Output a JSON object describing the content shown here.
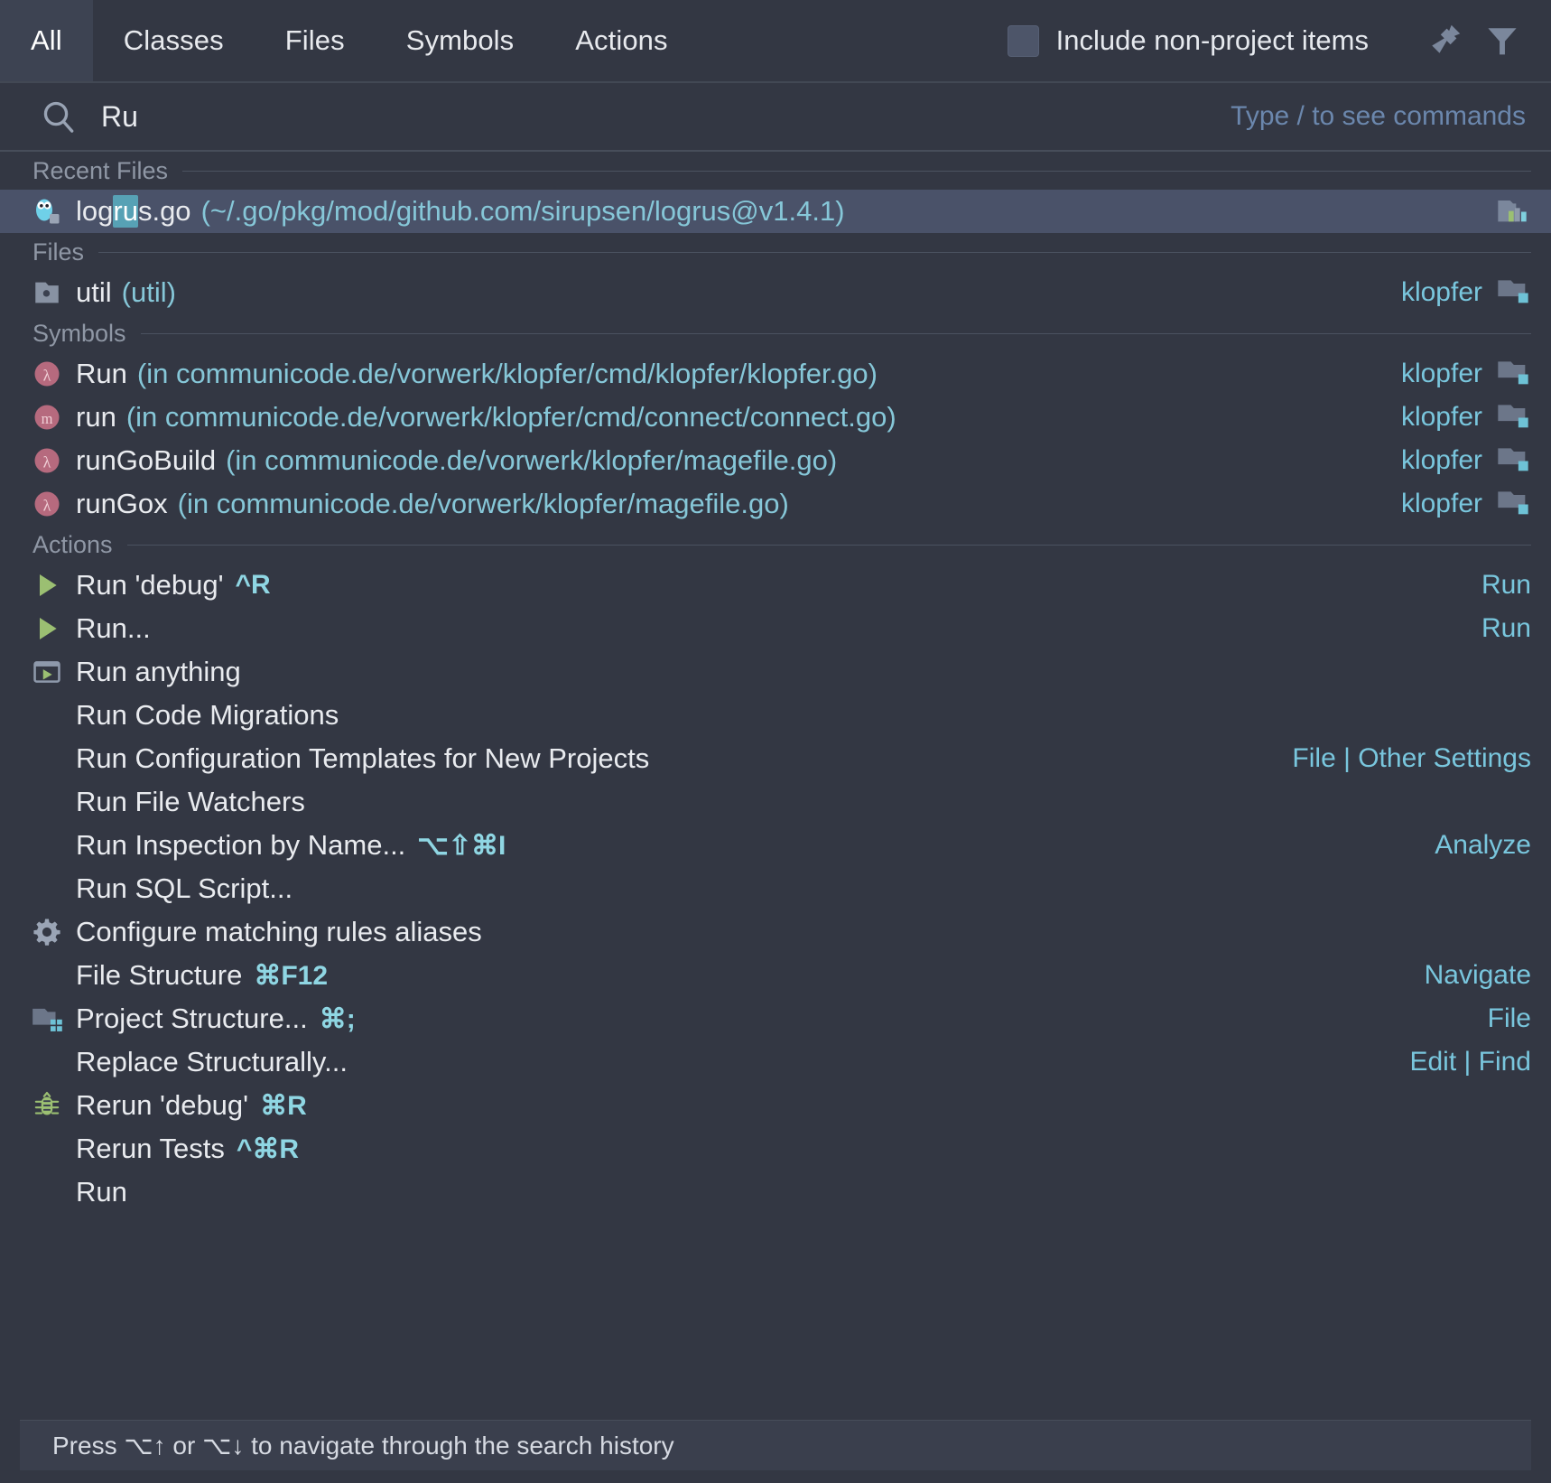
{
  "dialog": {
    "name": "Search Everywhere"
  },
  "tabs": [
    {
      "label": "All",
      "active": true
    },
    {
      "label": "Classes",
      "active": false
    },
    {
      "label": "Files",
      "active": false
    },
    {
      "label": "Symbols",
      "active": false
    },
    {
      "label": "Actions",
      "active": false
    }
  ],
  "toolbar": {
    "include_non_project_label": "Include non-project items",
    "include_non_project_checked": false,
    "pin_icon": "pin-icon",
    "filter_icon": "filter-icon"
  },
  "search": {
    "icon": "search-icon",
    "value": "Ru",
    "placeholder": "Type / to see commands",
    "hint": "Type / to see commands",
    "match_prefix": "log",
    "match_highlight": "ru"
  },
  "groups": [
    {
      "title": "Recent Files"
    },
    {
      "title": "Files"
    },
    {
      "title": "Symbols"
    },
    {
      "title": "Actions"
    }
  ],
  "recent_files": [
    {
      "icon": "go-gopher-file-icon",
      "name_before": "log",
      "name_match": "ru",
      "name_after": "s.go",
      "location": "(~/.go/pkg/mod/github.com/sirupsen/logrus@v1.4.1)",
      "right_icon": "library-module-icon",
      "selected": true
    }
  ],
  "files": [
    {
      "icon": "folder-file-icon",
      "name": "util",
      "location": "(util)",
      "right_text": "klopfer",
      "right_icon": "module-icon"
    }
  ],
  "symbols": [
    {
      "icon": "lambda-function-icon",
      "name": "Run",
      "location": "(in communicode.de/vorwerk/klopfer/cmd/klopfer/klopfer.go)",
      "right_text": "klopfer",
      "right_icon": "module-icon"
    },
    {
      "icon": "method-icon",
      "name": "run",
      "location": "(in communicode.de/vorwerk/klopfer/cmd/connect/connect.go)",
      "right_text": "klopfer",
      "right_icon": "module-icon"
    },
    {
      "icon": "lambda-function-icon",
      "name": "runGoBuild",
      "location": "(in communicode.de/vorwerk/klopfer/magefile.go)",
      "right_text": "klopfer",
      "right_icon": "module-icon"
    },
    {
      "icon": "lambda-function-icon",
      "name": "runGox",
      "location": "(in communicode.de/vorwerk/klopfer/magefile.go)",
      "right_text": "klopfer",
      "right_icon": "module-icon"
    }
  ],
  "actions": [
    {
      "icon": "run-play-icon",
      "label": "Run 'debug'",
      "shortcut": "^R",
      "right_text": "Run"
    },
    {
      "icon": "run-play-icon",
      "label": "Run...",
      "shortcut": "",
      "right_text": "Run"
    },
    {
      "icon": "run-anything-icon",
      "label": "Run anything",
      "shortcut": "",
      "right_text": ""
    },
    {
      "icon": "",
      "label": "Run Code Migrations",
      "shortcut": "",
      "right_text": ""
    },
    {
      "icon": "",
      "label": "Run Configuration Templates for New Projects",
      "shortcut": "",
      "right_text": "File | Other Settings"
    },
    {
      "icon": "",
      "label": "Run File Watchers",
      "shortcut": "",
      "right_text": ""
    },
    {
      "icon": "",
      "label": "Run Inspection by Name...",
      "shortcut": "⌥⇧⌘I",
      "right_text": "Analyze"
    },
    {
      "icon": "",
      "label": "Run SQL Script...",
      "shortcut": "",
      "right_text": ""
    },
    {
      "icon": "gear-icon",
      "label": "Configure matching rules aliases",
      "shortcut": "",
      "right_text": ""
    },
    {
      "icon": "",
      "label": "File Structure",
      "shortcut": "⌘F12",
      "right_text": "Navigate"
    },
    {
      "icon": "project-structure-icon",
      "label": "Project Structure...",
      "shortcut": "⌘;",
      "right_text": "File"
    },
    {
      "icon": "",
      "label": "Replace Structurally...",
      "shortcut": "",
      "right_text": "Edit | Find"
    },
    {
      "icon": "debug-bug-icon",
      "label": "Rerun 'debug'",
      "shortcut": "⌘R",
      "right_text": ""
    },
    {
      "icon": "",
      "label": "Rerun Tests",
      "shortcut": "^⌘R",
      "right_text": ""
    },
    {
      "icon": "",
      "label": "Run",
      "shortcut": "",
      "right_text": ""
    }
  ],
  "footer": {
    "hint": "Press ⌥↑ or ⌥↓ to navigate through the search history"
  },
  "colors": {
    "background": "#333743",
    "selection": "#4a5269",
    "accent_cyan": "#79c6dd",
    "shortcut": "#8fd6e3",
    "group_label": "#8f97a5",
    "text": "#e9ebef",
    "highlight": "#57a1b5",
    "symbol_pink": "#c26d80",
    "run_green": "#9bbf72"
  }
}
